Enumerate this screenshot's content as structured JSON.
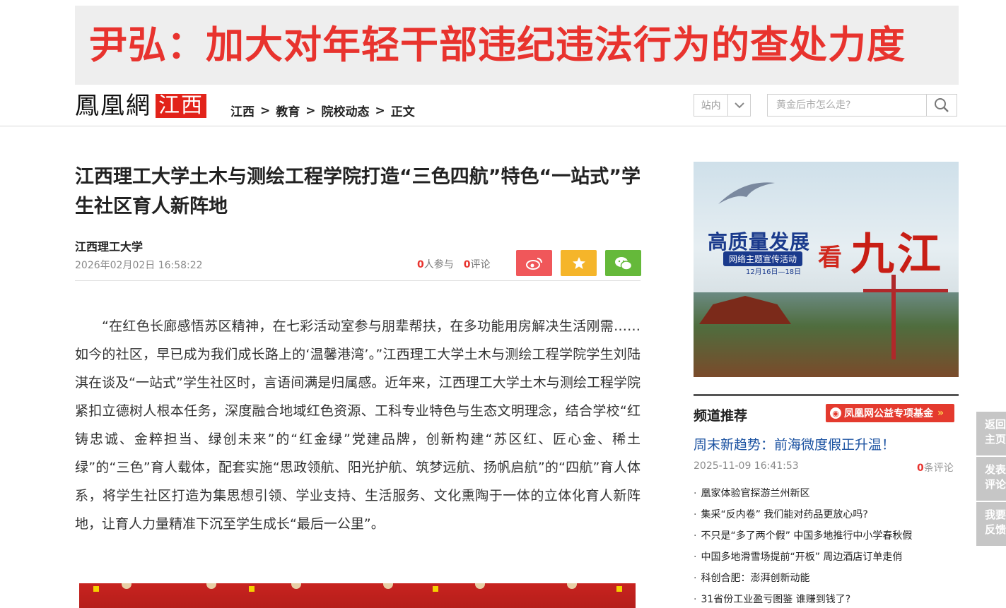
{
  "banner": {
    "headline": "尹弘：加大对年轻干部违纪违法行为的查处力度"
  },
  "header": {
    "logo_main": "鳳凰網",
    "logo_region": "江西",
    "breadcrumb": [
      "江西",
      "教育",
      "院校动态",
      "正文"
    ],
    "breadcrumb_sep": ">",
    "site_select_label": "站内",
    "search_placeholder": "黄金后市怎么走?"
  },
  "article": {
    "title": "江西理工大学土木与测绘工程学院打造“三色四航”特色“一站式”学生社区育人新阵地",
    "source": "江西理工大学",
    "datetime": "2026年02月02日 16:58:22",
    "participants_count": "0",
    "participants_label": "人参与",
    "comments_count": "0",
    "comments_label": "评论",
    "body": "“在红色长廊感悟苏区精神，在七彩活动室参与朋辈帮扶，在多功能用房解决生活刚需……如今的社区，早已成为我们成长路上的‘温馨港湾’。”江西理工大学土木与测绘工程学院学生刘陆淇在谈及“一站式”学生社区时，言语间满是归属感。近年来，江西理工大学土木与测绘工程学院紧扣立德树人根本任务，深度融合地域红色资源、工科专业特色与生态文明理念，结合学校“红铸忠诚、金粹担当、绿创未来”的“红金绿”党建品牌，创新构建“苏区红、匠心金、稀土绿”的“三色”育人载体，配套实施“思政领航、阳光护航、筑梦远航、扬帆启航”的“四航”育人体系，将学生社区打造为集思想引领、学业支持、生活服务、文化熏陶于一体的立体化育人新阵地，让育人力量精准下沉至学生成长“最后一公里”。"
  },
  "ad": {
    "title": "高质量发展",
    "subtitle": "网络主题宣传活动",
    "dates": "12月16日—18日",
    "kan": "看",
    "place": "九江"
  },
  "sidebar": {
    "section_title": "频道推荐",
    "badge_label": "凤凰网公益专项基金",
    "headline": "周末新趋势：前海微度假正升温！",
    "headline_date": "2025-11-09 16:41:53",
    "headline_comments_count": "0",
    "headline_comments_label": "条评论",
    "items": [
      "凰家体验官探游兰州新区",
      "集采“反内卷” 我们能对药品更放心吗?",
      "不只是“多了两个假” 中国多地推行中小学春秋假",
      "中国多地滑雪场提前“开板” 周边酒店订单走俏",
      "科创合肥：澎湃创新动能",
      "31省份工业盈亏图鉴 谁赚到钱了?"
    ]
  },
  "side_tools": [
    "返回主页",
    "发表评论",
    "我要反馈"
  ],
  "colors": {
    "brand_red": "#e2231a",
    "link_blue": "#1b52a1",
    "weibo": "#f0575a",
    "favorite": "#f5b52a",
    "wechat": "#65b93a"
  }
}
